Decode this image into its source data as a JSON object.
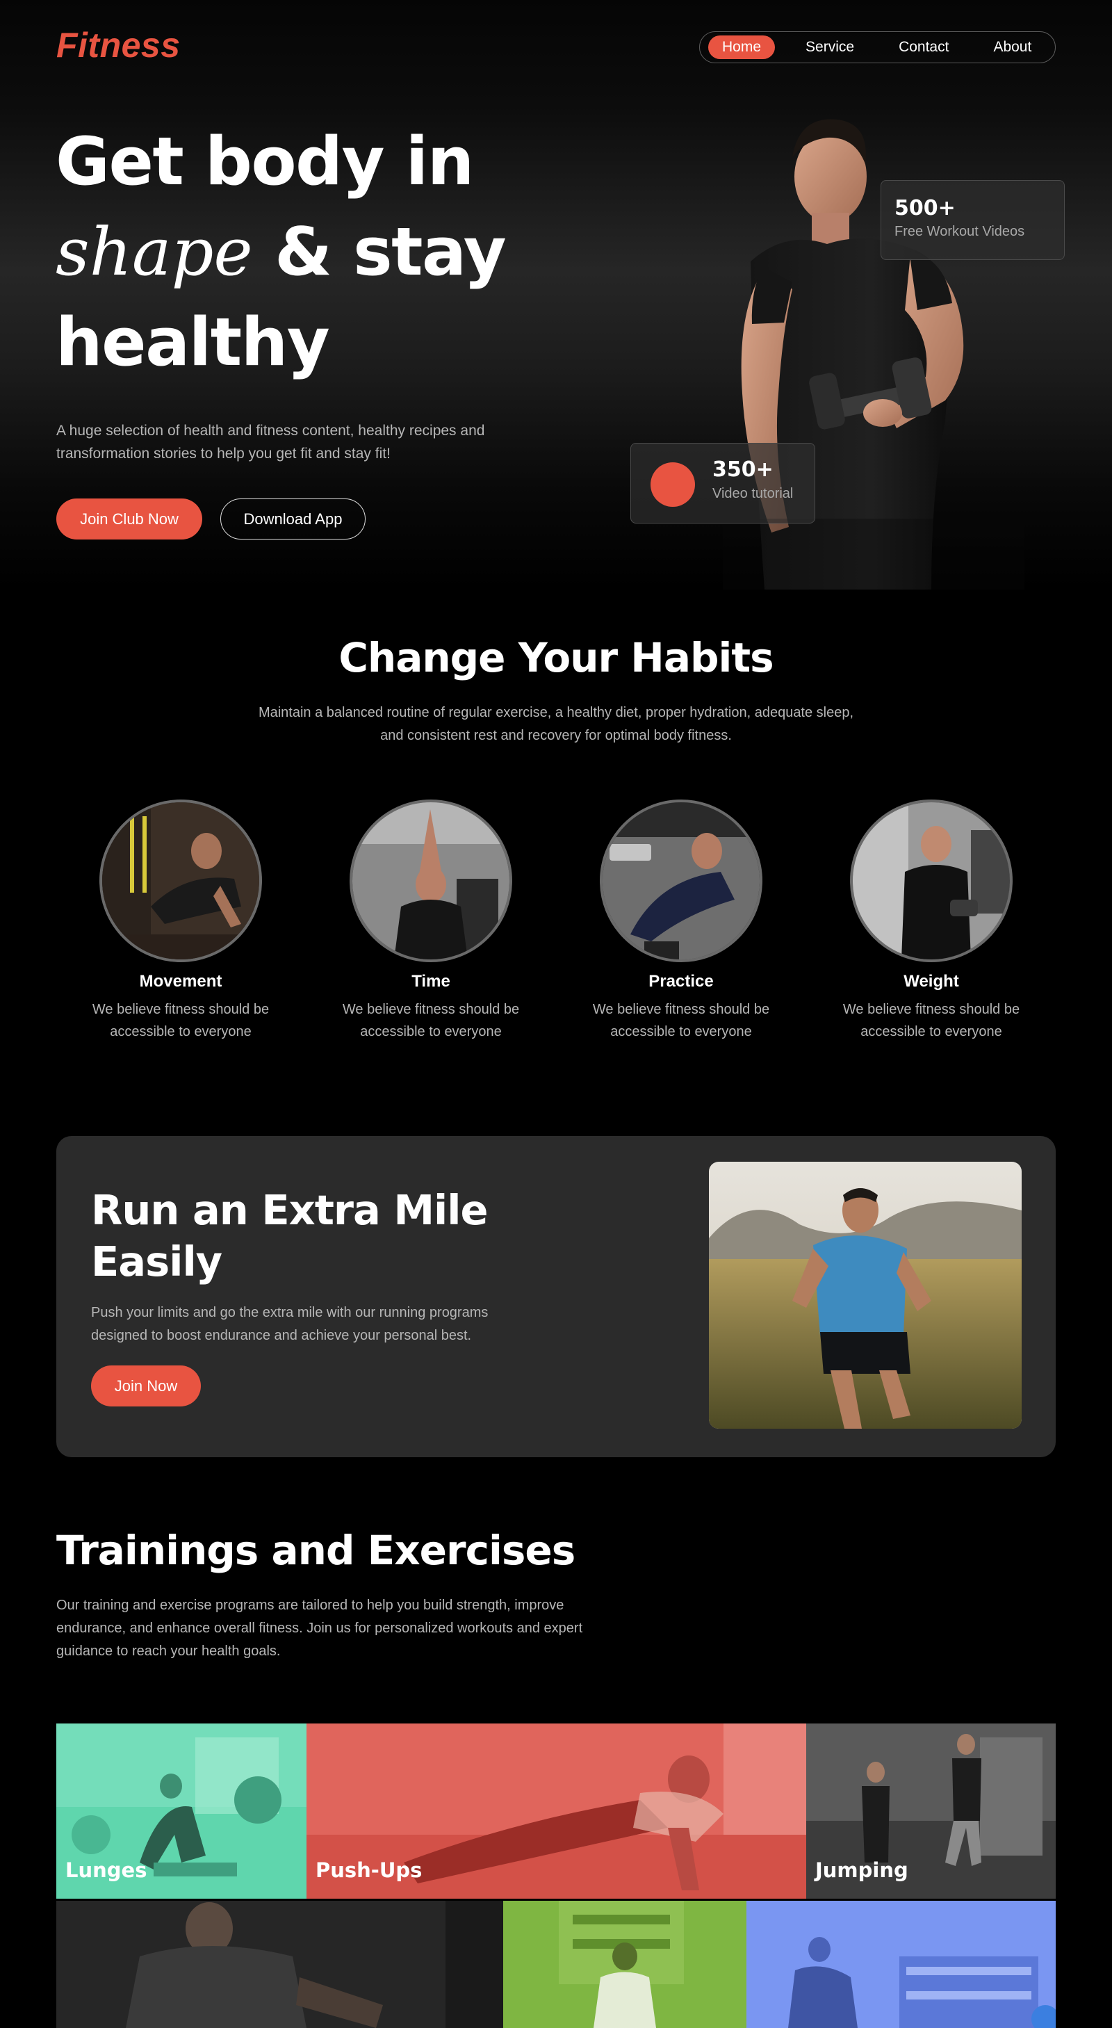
{
  "brand": {
    "logo": "Fitness",
    "accent": "#e85441"
  },
  "nav": {
    "items": [
      {
        "label": "Home",
        "active": true
      },
      {
        "label": "Service",
        "active": false
      },
      {
        "label": "Contact",
        "active": false
      },
      {
        "label": "About",
        "active": false
      }
    ]
  },
  "hero": {
    "title_line1": "Get body in",
    "title_script": "shape",
    "title_line2_rest": " & stay",
    "title_line3": "healthy",
    "description": "A huge selection of health and fitness content, healthy recipes and transformation stories to help you get fit and stay fit!",
    "primary_button": "Join Club Now",
    "secondary_button": "Download App",
    "stat_videos": {
      "number": "500+",
      "label": "Free Workout Videos"
    },
    "stat_tutorial": {
      "number": "350+",
      "label": "Video tutorial"
    }
  },
  "habits": {
    "title": "Change Your Habits",
    "description": "Maintain a balanced routine of regular exercise, a healthy diet, proper hydration, adequate sleep, and consistent rest and recovery for optimal body fitness.",
    "items": [
      {
        "title": "Movement",
        "description": "We believe fitness should be accessible to everyone"
      },
      {
        "title": "Time",
        "description": "We believe fitness should be accessible to everyone"
      },
      {
        "title": "Practice",
        "description": "We believe fitness should be accessible to everyone"
      },
      {
        "title": "Weight",
        "description": "We believe fitness should be accessible to everyone"
      }
    ]
  },
  "extra_mile": {
    "title": "Run an Extra Mile Easily",
    "description": "Push your limits and go the extra mile with our running programs designed to boost endurance and achieve your personal best.",
    "button": "Join Now"
  },
  "trainings": {
    "title": "Trainings and Exercises",
    "description": "Our training and exercise programs are tailored to help you build strength, improve endurance, and enhance overall fitness. Join us for personalized workouts and expert guidance to reach your health goals.",
    "tiles": [
      {
        "label": "Lunges",
        "color": "#5fd6ad"
      },
      {
        "label": "Push-Ups",
        "color": "#e0655c"
      },
      {
        "label": "Jumping",
        "color": "#3c3c3c"
      },
      {
        "label": "",
        "color": "#262626"
      },
      {
        "label": "",
        "color": "#7fb642"
      },
      {
        "label": "",
        "color": "#7a96f2"
      }
    ]
  }
}
